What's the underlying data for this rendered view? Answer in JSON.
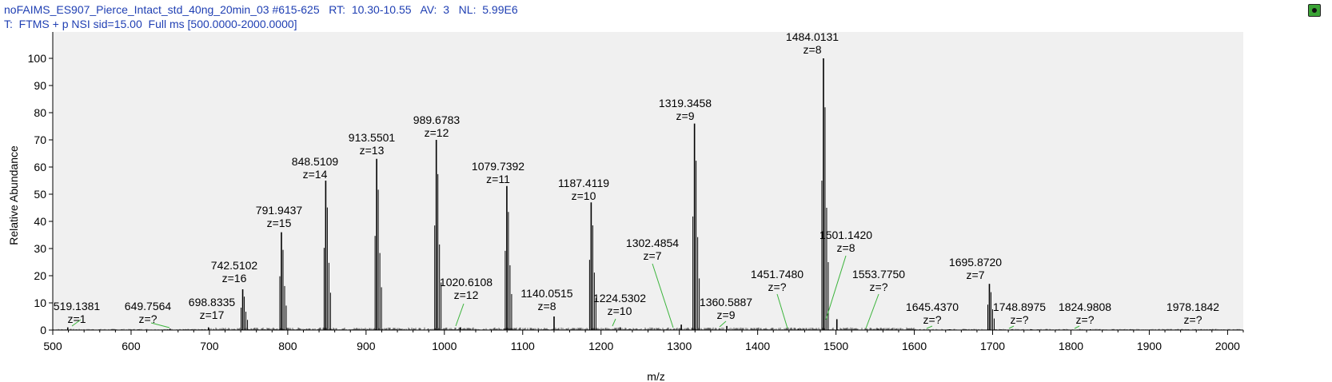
{
  "header": {
    "line1": "noFAIMS_ES907_Pierce_Intact_std_40ng_20min_03 #615-625   RT:  10.30-10.55   AV:  3   NL:  5.99E6",
    "line2": "T:  FTMS + p NSI sid=15.00  Full ms [500.0000-2000.0000]"
  },
  "chart_data": {
    "type": "line",
    "xlabel": "m/z",
    "ylabel": "Relative Abundance",
    "xlim": [
      500,
      2020
    ],
    "ylim": [
      0,
      100
    ],
    "xticks": [
      500,
      600,
      700,
      800,
      900,
      1000,
      1100,
      1200,
      1300,
      1400,
      1500,
      1600,
      1700,
      1800,
      1900,
      2000
    ],
    "yticks": [
      0,
      10,
      20,
      30,
      40,
      50,
      60,
      70,
      80,
      90,
      100
    ],
    "colors": {
      "trace": "#000000",
      "leader": "#3cb43c",
      "plot_bg": "#f0f0f0",
      "header_text": "#1f3fb3"
    },
    "peaks": [
      {
        "mz": 519.1381,
        "intensity": 1,
        "label": "519.1381",
        "z": "z=1"
      },
      {
        "mz": 649.7564,
        "intensity": 0.5,
        "label": "649.7564",
        "z": "z=?"
      },
      {
        "mz": 698.8335,
        "intensity": 1,
        "label": "698.8335",
        "z": "z=17"
      },
      {
        "mz": 742.5102,
        "intensity": 15,
        "label": "742.5102",
        "z": "z=16"
      },
      {
        "mz": 791.9437,
        "intensity": 36,
        "label": "791.9437",
        "z": "z=15"
      },
      {
        "mz": 848.5109,
        "intensity": 55,
        "label": "848.5109",
        "z": "z=14"
      },
      {
        "mz": 913.5501,
        "intensity": 63,
        "label": "913.5501",
        "z": "z=13"
      },
      {
        "mz": 989.6783,
        "intensity": 70,
        "label": "989.6783",
        "z": "z=12"
      },
      {
        "mz": 1020.6108,
        "intensity": 1,
        "label": "1020.6108",
        "z": "z=12"
      },
      {
        "mz": 1079.7392,
        "intensity": 53,
        "label": "1079.7392",
        "z": "z=11"
      },
      {
        "mz": 1140.0515,
        "intensity": 5,
        "label": "1140.0515",
        "z": "z=8"
      },
      {
        "mz": 1187.4119,
        "intensity": 47,
        "label": "1187.4119",
        "z": "z=10"
      },
      {
        "mz": 1224.5302,
        "intensity": 1,
        "label": "1224.5302",
        "z": "z=10"
      },
      {
        "mz": 1302.4854,
        "intensity": 2,
        "label": "1302.4854",
        "z": "z=7"
      },
      {
        "mz": 1319.3458,
        "intensity": 76,
        "label": "1319.3458",
        "z": "z=9"
      },
      {
        "mz": 1360.5887,
        "intensity": 1.5,
        "label": "1360.5887",
        "z": "z=9"
      },
      {
        "mz": 1451.748,
        "intensity": 0.5,
        "label": "1451.7480",
        "z": "z=?"
      },
      {
        "mz": 1484.0131,
        "intensity": 100,
        "label": "1484.0131",
        "z": "z=8"
      },
      {
        "mz": 1501.142,
        "intensity": 4,
        "label": "1501.1420",
        "z": "z=8"
      },
      {
        "mz": 1553.775,
        "intensity": 0.5,
        "label": "1553.7750",
        "z": "z=?"
      },
      {
        "mz": 1645.437,
        "intensity": 0.3,
        "label": "1645.4370",
        "z": "z=?"
      },
      {
        "mz": 1695.872,
        "intensity": 17,
        "label": "1695.8720",
        "z": "z=7"
      },
      {
        "mz": 1748.8975,
        "intensity": 0.3,
        "label": "1748.8975",
        "z": "z=?"
      },
      {
        "mz": 1824.9808,
        "intensity": 0.3,
        "label": "1824.9808",
        "z": "z=?"
      },
      {
        "mz": 1978.1842,
        "intensity": 0.2,
        "label": "1978.1842",
        "z": "z=?"
      }
    ]
  }
}
